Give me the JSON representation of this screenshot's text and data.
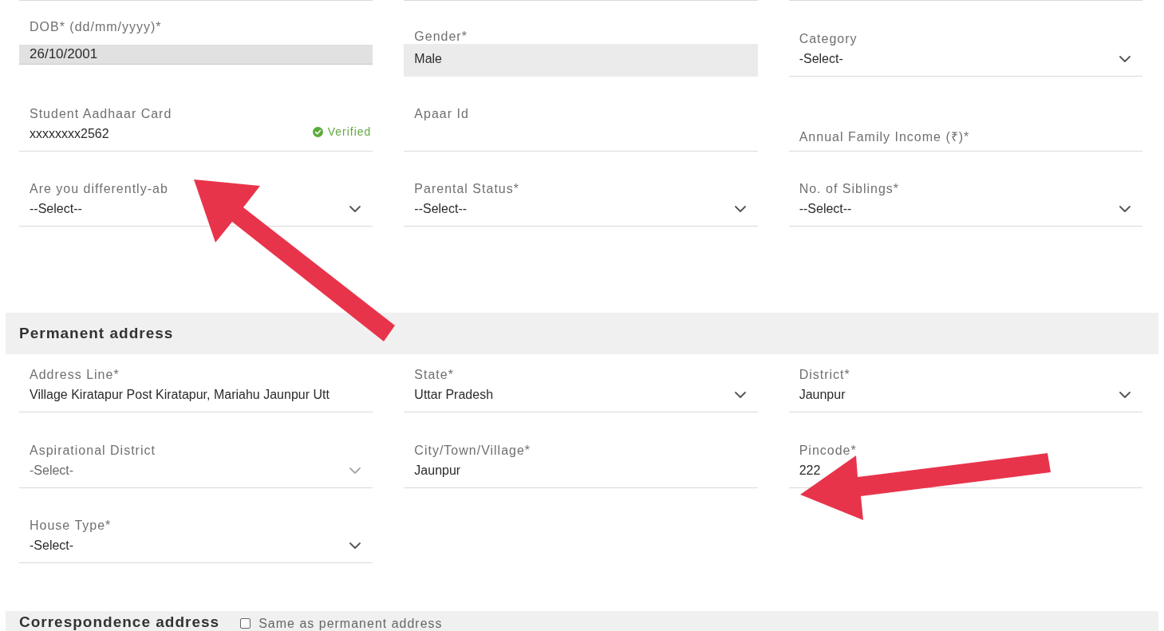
{
  "personal_details": {
    "fields": [
      {
        "kind": "date",
        "label": "DOB* (dd/mm/yyyy)*",
        "value": "26/10/2001",
        "disabled": true
      },
      {
        "kind": "text",
        "label": "Gender*",
        "value": "Male",
        "disabled": true
      },
      {
        "kind": "select",
        "label": "Category",
        "value": "-Select-",
        "disabled": false
      },
      {
        "kind": "text",
        "label": "Student Aadhaar Card",
        "value": "xxxxxxxx2562",
        "disabled": false,
        "status": "Verified"
      },
      {
        "kind": "text",
        "label": "Apaar Id",
        "disabled": false
      },
      {
        "kind": "text",
        "placeholder": "Annual Family Income (₹)*",
        "disabled": false
      },
      {
        "kind": "select",
        "label": "Are you differently-ab",
        "value": "--Select--",
        "disabled": false
      },
      {
        "kind": "select",
        "label": "Parental Status*",
        "value": "--Select--",
        "disabled": false
      },
      {
        "kind": "select",
        "label": "No. of Siblings*",
        "value": "--Select--",
        "disabled": false
      }
    ]
  },
  "permanent_address": {
    "title": "Permanent address",
    "fields": [
      {
        "kind": "text",
        "label": "Address Line*",
        "value": "Village Kiratapur Post Kiratapur, Mariahu Jaunpur Utt",
        "disabled": false
      },
      {
        "kind": "select",
        "label": "State*",
        "value": "Uttar Pradesh",
        "disabled": false
      },
      {
        "kind": "select",
        "label": "District*",
        "value": "Jaunpur",
        "disabled": false
      },
      {
        "kind": "select",
        "label": "Aspirational District",
        "value": "-Select-",
        "disabled": true
      },
      {
        "kind": "text",
        "label": "City/Town/Village*",
        "value": "Jaunpur",
        "disabled": false
      },
      {
        "kind": "text",
        "label": "Pincode*",
        "value": "222",
        "disabled": false
      },
      {
        "kind": "select",
        "label": "House Type*",
        "value": "-Select-",
        "disabled": false
      }
    ]
  },
  "correspondence_address": {
    "title": "Correspondence address",
    "same_as_permanent": {
      "label": "Same as permanent address",
      "checked": false
    }
  }
}
